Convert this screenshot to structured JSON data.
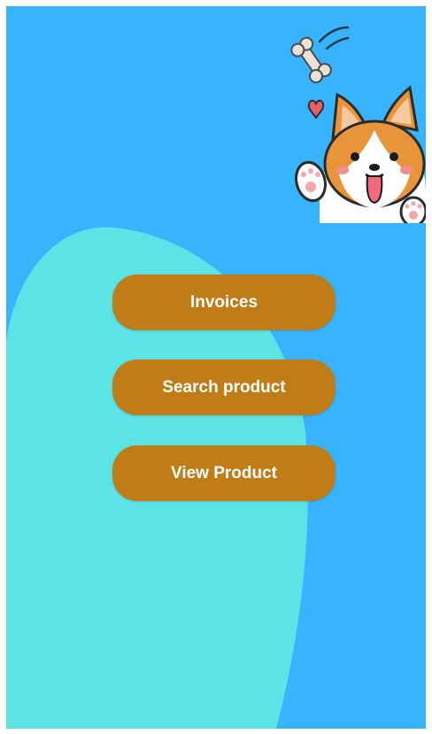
{
  "colors": {
    "background": "#37b4fc",
    "blob": "#5ce3e6",
    "button": "#c07c16",
    "button_text": "#ffffff"
  },
  "illustration": {
    "icon": "corgi-with-bone-sticker"
  },
  "menu": {
    "invoices_label": "Invoices",
    "search_product_label": "Search product",
    "view_product_label": "View Product"
  }
}
